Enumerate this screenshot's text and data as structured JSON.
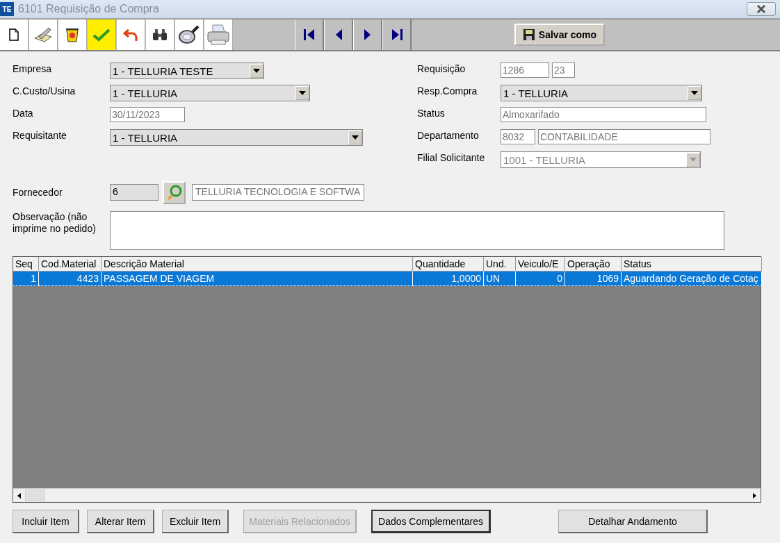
{
  "window": {
    "title": "6101 Requisição de Compra",
    "app_icon": "TE"
  },
  "toolbar": [
    {
      "kind": "new",
      "highlighted": false
    },
    {
      "kind": "edit",
      "highlighted": false
    },
    {
      "kind": "delete",
      "highlighted": false
    },
    {
      "kind": "confirm",
      "highlighted": true
    },
    {
      "kind": "undo",
      "highlighted": false
    },
    {
      "kind": "find",
      "highlighted": false
    },
    {
      "kind": "lookup",
      "highlighted": false
    },
    {
      "kind": "print",
      "highlighted": false
    }
  ],
  "navigation": [
    {
      "kind": "first"
    },
    {
      "kind": "prev"
    },
    {
      "kind": "next"
    },
    {
      "kind": "last"
    }
  ],
  "save_as_button": "Salvar como",
  "left_fields": [
    {
      "label": "Empresa",
      "boxes": [
        {
          "kind": "combo",
          "value": "1 - TELLURIA TESTE",
          "disabled": false
        }
      ]
    },
    {
      "label": "C.Custo/Usina",
      "boxes": [
        {
          "kind": "combo",
          "value": "1 - TELLURIA",
          "disabled": false
        }
      ]
    },
    {
      "label": "Data",
      "boxes": [
        {
          "kind": "text",
          "value": "30/11/2023"
        }
      ]
    },
    {
      "label": "Requisitante",
      "boxes": [
        {
          "kind": "combo",
          "value": "1 - TELLURIA",
          "disabled": false
        }
      ]
    }
  ],
  "right_fields": [
    {
      "label": "Requisição",
      "boxes": [
        {
          "kind": "text",
          "value": "1286"
        },
        {
          "kind": "text",
          "value": "23"
        }
      ]
    },
    {
      "label": "Resp.Compra",
      "boxes": [
        {
          "kind": "combo",
          "value": "1 - TELLURIA",
          "disabled": false
        }
      ]
    },
    {
      "label": "Status",
      "boxes": [
        {
          "kind": "text",
          "value": "Almoxarifado"
        }
      ]
    },
    {
      "label": "Departamento",
      "boxes": [
        {
          "kind": "text",
          "value": "8032"
        },
        {
          "kind": "text",
          "value": "CONTABILIDADE"
        }
      ]
    },
    {
      "label": "Filial Solicitante",
      "boxes": [
        {
          "kind": "combo",
          "value": "1001 - TELLURIA",
          "disabled": true
        }
      ]
    }
  ],
  "supplier": {
    "label": "Fornecedor",
    "code": "6",
    "name": "TELLURIA TECNOLOGIA E SOFTWA"
  },
  "note": {
    "label": "Observação (não imprime no pedido)"
  },
  "table": {
    "columns": [
      "Seq",
      "Cod.Material",
      "Descrição Material",
      "Quantidade",
      "Und.",
      "Veiculo/E",
      "Operação",
      "Status"
    ],
    "rows": [
      {
        "cells": [
          "1",
          "4423",
          "PASSAGEM DE VIAGEM",
          "1,0000",
          "UN",
          "0",
          "1069",
          "Aguardando Geração de Cotaç"
        ],
        "selected": true
      }
    ]
  },
  "buttons": [
    {
      "label": "Incluir Item",
      "disabled": false,
      "default": false
    },
    {
      "label": "Alterar Item",
      "disabled": false,
      "default": false
    },
    {
      "label": "Excluir Item",
      "disabled": false,
      "default": false
    },
    {
      "label": "Materiais Relacionados",
      "disabled": true,
      "default": false
    },
    {
      "label": "Dados Complementares",
      "disabled": false,
      "default": true
    },
    {
      "label": "Detalhar Andamento",
      "disabled": false,
      "default": false
    }
  ]
}
